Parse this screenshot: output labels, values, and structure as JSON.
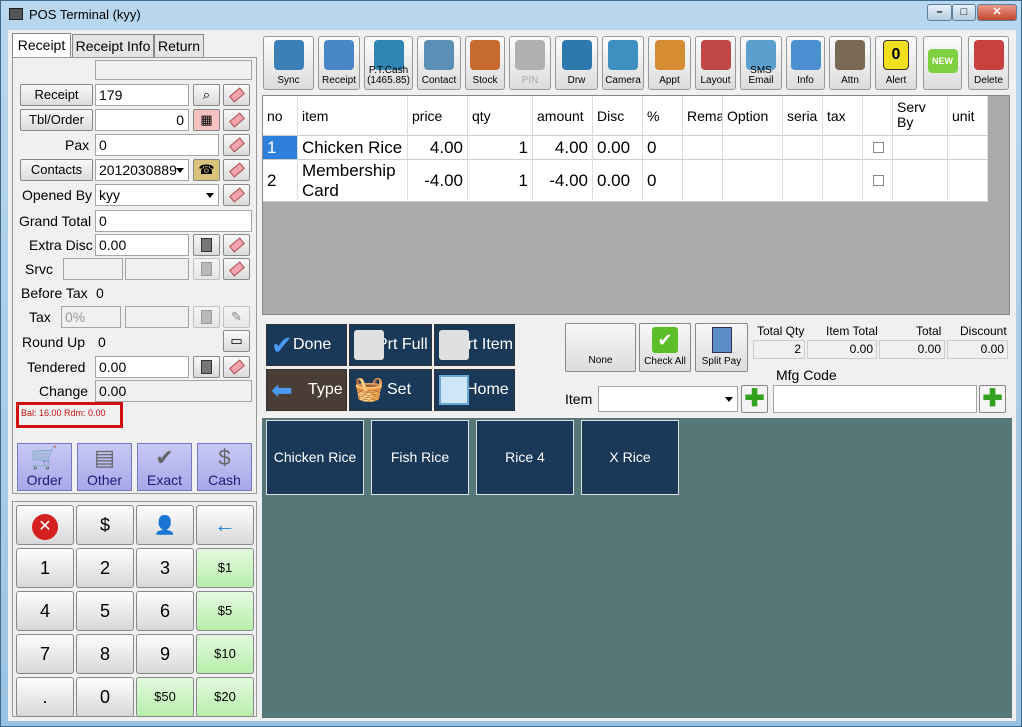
{
  "window": {
    "title": "POS Terminal (kyy)",
    "min": "–",
    "max": "□",
    "close": "✕"
  },
  "tabs": [
    "Receipt",
    "Receipt Info",
    "Return"
  ],
  "form": {
    "receipt_btn": "Receipt",
    "receipt_no": "179",
    "tbl_btn": "Tbl/Order",
    "tbl_value": "0",
    "pax_label": "Pax",
    "pax_value": "0",
    "contacts_btn": "Contacts",
    "contacts_value": "2012030889",
    "opened_by_label": "Opened By",
    "opened_by_value": "kyy",
    "grand_total_label": "Grand Total",
    "grand_total_value": "0",
    "extra_disc_label": "Extra Disc",
    "extra_disc_value": "0.00",
    "srvc_label": "Srvc",
    "before_tax_label": "Before Tax",
    "before_tax_value": "0",
    "tax_label": "Tax",
    "tax_value": "0%",
    "round_up_label": "Round Up",
    "round_up_value": "0",
    "tendered_label": "Tendered",
    "tendered_value": "0.00",
    "change_label": "Change",
    "change_value": "0.00",
    "balance_text": "Bal: 16.00 Rdm: 0.00"
  },
  "payments": [
    {
      "label": "Order",
      "icon": "cart-icon"
    },
    {
      "label": "Other",
      "icon": "card-icon"
    },
    {
      "label": "Exact",
      "icon": "check-icon"
    },
    {
      "label": "Cash",
      "icon": "dollar-icon"
    }
  ],
  "keypad": {
    "row1": [
      "✕",
      "$",
      "👤",
      "←"
    ],
    "keys": [
      "1",
      "2",
      "3",
      "$1",
      "4",
      "5",
      "6",
      "$5",
      "7",
      "8",
      "9",
      "$10",
      ".",
      "0",
      "$50",
      "$20"
    ]
  },
  "toolbar": [
    {
      "label": "Sync",
      "icon": "sync-icon",
      "color": "#3a7fb8"
    },
    {
      "label": "Receipt",
      "icon": "receipt-icon",
      "color": "#4a87c8"
    },
    {
      "label": "P.T.Cash\n(1465.85)",
      "icon": "key-icon",
      "color": "#2f86b5"
    },
    {
      "label": "Contact",
      "icon": "contact-icon",
      "color": "#5b8fb5"
    },
    {
      "label": "Stock",
      "icon": "stock-icon",
      "color": "#c66a2f"
    },
    {
      "label": "PIN",
      "icon": "pin-icon",
      "color": "#b0b0b0"
    },
    {
      "label": "Drw",
      "icon": "drawer-icon",
      "color": "#2c79b0"
    },
    {
      "label": "Camera",
      "icon": "camera-icon",
      "color": "#3f8fc0"
    },
    {
      "label": "Appt",
      "icon": "appt-icon",
      "color": "#d58c32"
    },
    {
      "label": "Layout",
      "icon": "layout-icon",
      "color": "#c04848"
    },
    {
      "label": "SMS\nEmail",
      "icon": "sms-icon",
      "color": "#5b9fcf"
    },
    {
      "label": "Info",
      "icon": "info-icon",
      "color": "#4a8fcf"
    },
    {
      "label": "Attn",
      "icon": "attn-icon",
      "color": "#7a6a55"
    },
    {
      "label": "Alert",
      "icon": "alert-icon",
      "color": "#f0e020"
    },
    {
      "label": "",
      "icon": "new-icon",
      "color": "#7fd040"
    },
    {
      "label": "Delete",
      "icon": "delete-icon",
      "color": "#c84040"
    }
  ],
  "alert_count": "0",
  "new_label": "NEW",
  "grid": {
    "headers": [
      "no",
      "item",
      "price",
      "qty",
      "amount",
      "Disc",
      "%",
      "Rema",
      "Option",
      "seria",
      "tax",
      "",
      "Serv\nBy",
      "unit"
    ],
    "rows": [
      {
        "no": "1",
        "item": "Chicken Rice",
        "price": "4.00",
        "qty": "1",
        "amount": "4.00",
        "disc": "0.00",
        "pct": "0"
      },
      {
        "no": "2",
        "item": "Membership\nCard",
        "price": "-4.00",
        "qty": "1",
        "amount": "-4.00",
        "disc": "0.00",
        "pct": "0"
      }
    ]
  },
  "actions": {
    "done": "Done",
    "prt_full": "Prt Full",
    "prt_item": "Prt Item",
    "type": "Type",
    "set": "Set",
    "home": "Home",
    "none": "None",
    "check_all": "Check All",
    "split_pay": "Split Pay"
  },
  "summary": {
    "total_qty_label": "Total Qty",
    "total_qty": "2",
    "item_total_label": "Item Total",
    "item_total": "0.00",
    "total_label": "Total",
    "total": "0.00",
    "discount_label": "Discount",
    "discount": "0.00"
  },
  "item_label": "Item",
  "mfg_label": "Mfg Code",
  "products": [
    "Chicken Rice",
    "Fish Rice",
    "Rice 4",
    "X Rice"
  ]
}
